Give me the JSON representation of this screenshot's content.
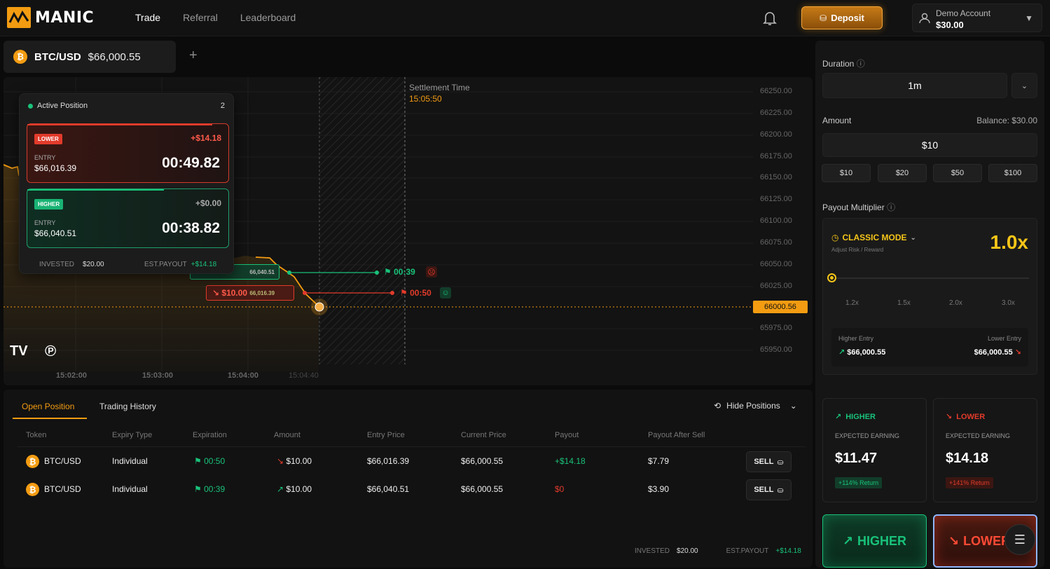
{
  "app": {
    "brand": "MANIC"
  },
  "nav": {
    "items": [
      "Trade",
      "Referral",
      "Leaderboard"
    ],
    "active": "Trade"
  },
  "header": {
    "deposit_label": "Deposit",
    "account_label": "Demo Account",
    "account_balance": "$30.00"
  },
  "pair_tab": {
    "symbol": "BTC/USD",
    "price": "$66,000.55",
    "icon_letter": "₿"
  },
  "chart": {
    "settlement_label": "Settlement Time",
    "settlement_time": "15:05:50",
    "y_ticks": [
      "66250.00",
      "66225.00",
      "66200.00",
      "66175.00",
      "66150.00",
      "66125.00",
      "66100.00",
      "66075.00",
      "66050.00",
      "66025.00",
      "66000.56",
      "65975.00",
      "65950.00"
    ],
    "current_price_tag": "66000.56",
    "x_ticks": [
      "15:02:00",
      "15:03:00",
      "15:04:00",
      "15:04:40"
    ],
    "marker_higher": {
      "price": "66,040.51",
      "countdown": "00:39"
    },
    "marker_lower": {
      "amount": "$10.00",
      "price": "66,016.39",
      "countdown": "00:50"
    }
  },
  "active_position": {
    "title": "Active Position",
    "count": "2",
    "cards": [
      {
        "direction": "LOWER",
        "gain": "+$14.18",
        "entry_label": "ENTRY",
        "entry": "$66,016.39",
        "timer": "00:49.82"
      },
      {
        "direction": "HIGHER",
        "gain": "+$0.00",
        "entry_label": "ENTRY",
        "entry": "$66,040.51",
        "timer": "00:38.82"
      }
    ],
    "invested_label": "INVESTED",
    "invested": "$20.00",
    "est_label": "EST.PAYOUT",
    "est": "+$14.18"
  },
  "bottom": {
    "tabs": [
      "Open Position",
      "Trading History"
    ],
    "hide_label": "Hide Positions",
    "columns": [
      "Token",
      "Expiry Type",
      "Expiration",
      "Amount",
      "Entry Price",
      "Current Price",
      "Payout",
      "Payout After Sell"
    ],
    "rows": [
      {
        "token": "BTC/USD",
        "expiry": "Individual",
        "expiration": "00:50",
        "amount": "$10.00",
        "entry": "$66,016.39",
        "current": "$66,000.55",
        "payout": "+$14.18",
        "after": "$7.79",
        "sell": "SELL",
        "dir": "down"
      },
      {
        "token": "BTC/USD",
        "expiry": "Individual",
        "expiration": "00:39",
        "amount": "$10.00",
        "entry": "$66,040.51",
        "current": "$66,000.55",
        "payout": "$0",
        "after": "$3.90",
        "sell": "SELL",
        "dir": "up"
      }
    ],
    "invested_label": "INVESTED",
    "invested": "$20.00",
    "est_label": "EST.PAYOUT",
    "est": "+$14.18"
  },
  "side": {
    "duration_label": "Duration",
    "duration_value": "1m",
    "amount_label": "Amount",
    "balance_label": "Balance: $30.00",
    "amount_value": "$10",
    "quick": [
      "$10",
      "$20",
      "$50",
      "$100"
    ],
    "payout_label": "Payout Multiplier",
    "mode": "CLASSIC MODE",
    "mode_sub": "Adjust Risk / Reward",
    "multiplier": "1.0x",
    "slider_ticks": [
      "1.2x",
      "1.5x",
      "2.0x",
      "3.0x"
    ],
    "multiplier_level": 0,
    "higher_entry_label": "Higher Entry",
    "higher_entry": "$66,000.55",
    "lower_entry_label": "Lower Entry",
    "lower_entry": "$66,000.55",
    "higher": {
      "title": "HIGHER",
      "ee": "EXPECTED EARNING",
      "value": "$11.47",
      "ret": "+114% Return"
    },
    "lower": {
      "title": "LOWER",
      "ee": "EXPECTED EARNING",
      "value": "$14.18",
      "ret": "+141% Return"
    },
    "btn_higher": "HIGHER",
    "btn_lower": "LOWER"
  },
  "colors": {
    "accent": "#f39c12",
    "green": "#19c27a",
    "red": "#e23b2b"
  }
}
